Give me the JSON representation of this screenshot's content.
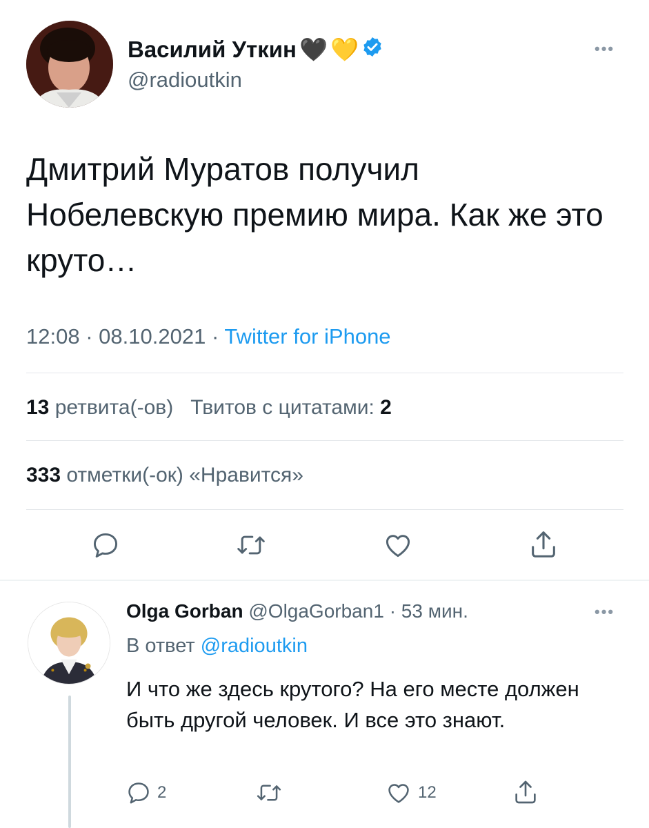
{
  "tweet": {
    "author_name": "Василий Уткин",
    "emoji": [
      "🖤",
      "💛"
    ],
    "verified_icon": "verified-badge-icon",
    "handle": "@radioutkin",
    "text": "Дмитрий Муратов получил Нобелевскую премию мира. Как же это круто…",
    "time": "12:08",
    "date": "08.10.2021",
    "separator": "·",
    "source": "Twitter for iPhone",
    "retweets_count": "13",
    "retweets_label": "ретвита(-ов)",
    "quotes_label": "Твитов с цитатами:",
    "quotes_count": "2",
    "likes_count": "333",
    "likes_label": "отметки(-ок) «Нравится»",
    "more_icon": "more-icon",
    "actions": [
      "reply-icon",
      "retweet-icon",
      "like-icon",
      "share-icon"
    ]
  },
  "reply": {
    "author_name": "Olga Gorban",
    "handle": "@OlgaGorban1",
    "separator": "·",
    "time": "53 мин.",
    "in_reply_prefix": "В ответ",
    "in_reply_to": "@radioutkin",
    "text": "И что же здесь крутого? На его месте должен быть другой человек. И все это знают.",
    "reply_count": "2",
    "like_count": "12"
  },
  "colors": {
    "accent": "#1d9bf0",
    "text": "#0f1419",
    "secondary": "#536471",
    "divider": "#e3e7ea"
  }
}
